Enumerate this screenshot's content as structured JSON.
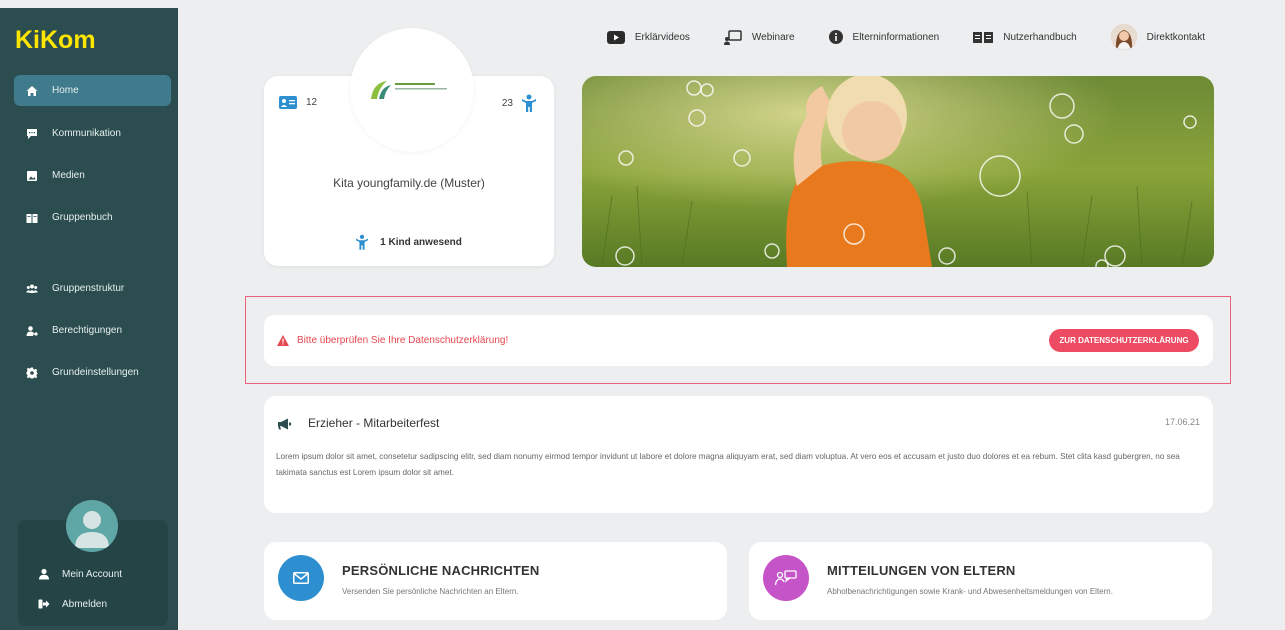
{
  "sidebar": {
    "logo": "KiKom",
    "items": [
      {
        "label": "Home",
        "icon": "home-icon",
        "active": true
      },
      {
        "label": "Kommunikation",
        "icon": "chat-icon"
      },
      {
        "label": "Medien",
        "icon": "image-icon"
      },
      {
        "label": "Gruppenbuch",
        "icon": "book-icon"
      },
      {
        "label": "Gruppenstruktur",
        "icon": "users-icon"
      },
      {
        "label": "Berechtigungen",
        "icon": "user-key-icon"
      },
      {
        "label": "Grundeinstellungen",
        "icon": "gear-icon"
      }
    ],
    "account": {
      "my_account": "Mein Account",
      "logout": "Abmelden"
    }
  },
  "topnav": {
    "items": [
      {
        "label": "Erklärvideos",
        "icon": "video-icon"
      },
      {
        "label": "Webinare",
        "icon": "webinar-icon"
      },
      {
        "label": "Elterninformationen",
        "icon": "info-icon"
      },
      {
        "label": "Nutzerhandbuch",
        "icon": "handbook-icon"
      },
      {
        "label": "Direktkontakt",
        "icon": "contact-avatar"
      }
    ]
  },
  "kita": {
    "logo_text": "KITA youngfamily.de",
    "staff_count": "12",
    "children_count": "23",
    "name": "Kita youngfamily.de (Muster)",
    "present": "1 Kind anwesend"
  },
  "alert": {
    "text": "Bitte überprüfen Sie Ihre Datenschutzerklärung!",
    "button": "ZUR DATENSCHUTZERKLÄRUNG"
  },
  "news": {
    "title": "Erzieher - Mitarbeiterfest",
    "date": "17.06.21",
    "body": "Lorem ipsum dolor sit amet, consetetur sadipscing elitr, sed diam nonumy eirmod tempor invidunt ut labore et dolore magna aliquyam erat, sed diam voluptua. At vero eos et accusam et justo duo dolores et ea rebum. Stet clita kasd gubergren, no sea takimata sanctus est Lorem ipsum dolor sit amet."
  },
  "cards": [
    {
      "title": "PERSÖNLICHE NACHRICHTEN",
      "subtitle": "Versenden Sie persönliche Nachrichten an Eltern.",
      "color": "#2e8fd0"
    },
    {
      "title": "MITTEILUNGEN VON ELTERN",
      "subtitle": "Abholbenachrichtigungen sowie Krank- und Abwesenheitsmeldungen von Eltern.",
      "color": "#c554c9"
    }
  ],
  "colors": {
    "sidebar_bg": "#2b4d4f",
    "active_item": "#3f7b8d",
    "logo": "#ffe600",
    "alert": "#ec4b63",
    "accent_blue": "#2e8fd0"
  }
}
